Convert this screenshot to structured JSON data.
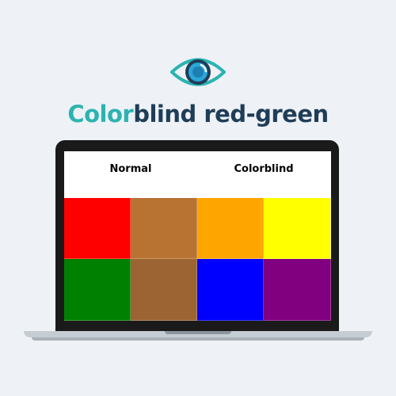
{
  "title": {
    "accent": "Color",
    "rest": "blind red-green"
  },
  "columns": {
    "normal": "Normal",
    "colorblind": "Colorblind"
  },
  "swatches": [
    {
      "color": "#ff0000"
    },
    {
      "color": "#b87333"
    },
    {
      "color": "#ffa500"
    },
    {
      "color": "#ffff00"
    },
    {
      "color": "#008000"
    },
    {
      "color": "#9c6433"
    },
    {
      "color": "#0000ff"
    },
    {
      "color": "#800080"
    }
  ],
  "icons": {
    "logo": "eye-icon"
  },
  "colors": {
    "accent": "#2bb3b1",
    "dark": "#1f3d57",
    "iris": "#2aa6d9"
  }
}
